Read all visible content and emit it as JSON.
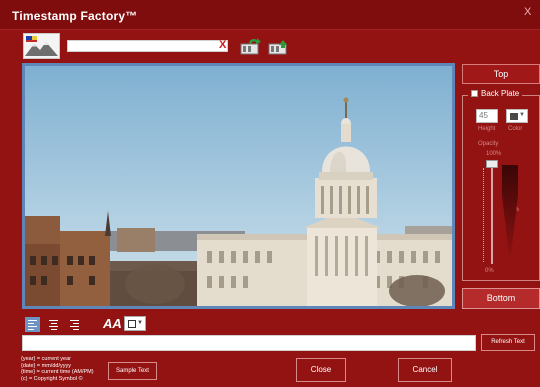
{
  "window": {
    "title": "Timestamp Factory™",
    "close_glyph": "X"
  },
  "toolbar": {
    "image_path_value": "",
    "clear_glyph": "X",
    "load_icon": "load-template-icon",
    "save_icon": "save-template-icon"
  },
  "position": {
    "top_label": "Top",
    "bottom_label": "Bottom"
  },
  "back_plate": {
    "label": "Back Plate",
    "checked": false,
    "height_value": "45",
    "height_label": "Height",
    "color_label": "Color",
    "opacity_label": "Opacity",
    "opacity_top": "100%",
    "opacity_mid": "50%",
    "opacity_bottom": "0%",
    "color": "#4a4a4a"
  },
  "text": {
    "value": "",
    "refresh_label": "Refresh Text",
    "font_label": "AA",
    "text_color": "#ffffff"
  },
  "legend": [
    "{year} = current year",
    "{date} = mm/dd/yyyy",
    "{time} = current time (AM/PM)",
    "(c) = Copyright Symbol ©"
  ],
  "footer": {
    "sample_label": "Sample Text",
    "close_label": "Close",
    "cancel_label": "Cancel"
  },
  "colors": {
    "background": "#931212",
    "titlebar": "#7f0d0d",
    "accent_blue": "#6e93c5"
  }
}
